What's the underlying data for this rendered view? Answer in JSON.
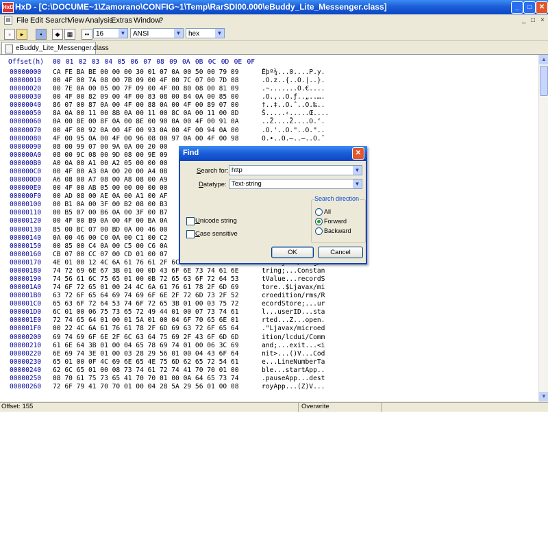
{
  "window": {
    "title": "HxD - [C:\\DOCUME~1\\Zamorano\\CONFIG~1\\Temp\\RarSDI00.000\\eBuddy_Lite_Messenger.class]",
    "app_icon": "HxD",
    "minimize": "_",
    "maximize": "□",
    "close": "✕"
  },
  "menu": {
    "items": [
      "File",
      "Edit",
      "Search",
      "View",
      "Analysis",
      "Extras",
      "Window",
      "?"
    ],
    "mdi_controls": [
      "_",
      "□",
      "×"
    ]
  },
  "toolbar": {
    "bytes_per_row": "16",
    "charset": "ANSI",
    "offset_base": "hex"
  },
  "tab": {
    "label": "eBuddy_Lite_Messenger.class"
  },
  "editor": {
    "header_label": "Offset(h)",
    "header_cols": [
      "00",
      "01",
      "02",
      "03",
      "04",
      "05",
      "06",
      "07",
      "08",
      "09",
      "0A",
      "0B",
      "0C",
      "0D",
      "0E",
      "0F"
    ],
    "rows": [
      {
        "off": "00000000",
        "hex": "CA FE BA BE 00 00 00 30 01 07 0A 00 50 00 79 09",
        "asc": "Êþº¾...0....P.y."
      },
      {
        "off": "00000010",
        "hex": "00 4F 00 7A 08 00 7B 09 00 4F 00 7C 07 00 7D 08",
        "asc": ".O.z..{..O.|..}."
      },
      {
        "off": "00000020",
        "hex": "00 7E 0A 00 05 00 7F 09 00 4F 00 80 08 00 81 09",
        "asc": ".~.......O.€...."
      },
      {
        "off": "00000030",
        "hex": "00 4F 00 82 09 00 4F 00 83 08 00 84 0A 00 85 00",
        "asc": ".O.‚..O.ƒ..„..…."
      },
      {
        "off": "00000040",
        "hex": "86 07 00 87 0A 00 4F 00 88 0A 00 4F 00 89 07 00",
        "asc": "†..‡..O.ˆ..O.‰.."
      },
      {
        "off": "00000050",
        "hex": "8A 0A 00 11 00 8B 0A 00 11 00 8C 0A 00 11 00 8D",
        "asc": "Š.....‹.....Œ...."
      },
      {
        "off": "00000060",
        "hex": "0A 00 8E 00 8F 0A 00 8E 00 90 0A 00 4F 00 91 0A",
        "asc": "..Ž....Ž....O.‘."
      },
      {
        "off": "00000070",
        "hex": "00 4F 00 92 0A 00 4F 00 93 0A 00 4F 00 94 0A 00",
        "asc": ".O.'..O.\"..O.\".."
      },
      {
        "off": "00000080",
        "hex": "4F 00 95 0A 00 4F 00 96 08 00 97 0A 00 4F 00 98",
        "asc": "O.•..O.–..—..O.˜"
      },
      {
        "off": "00000090",
        "hex": "08 00 99 07 00 9A 0A 00 20 00",
        "asc": ""
      },
      {
        "off": "000000A0",
        "hex": "08 00 9C 08 00 9D 08 00 9E 09",
        "asc": ""
      },
      {
        "off": "000000B0",
        "hex": "A0 0A 00 A1 00 A2 05 00 00 00",
        "asc": ""
      },
      {
        "off": "000000C0",
        "hex": "00 4F 00 A3 0A 00 20 00 A4 08",
        "asc": ""
      },
      {
        "off": "000000D0",
        "hex": "A6 08 00 A7 08 00 A8 08 00 A9",
        "asc": ""
      },
      {
        "off": "000000E0",
        "hex": "00 4F 00 AB 05 00 00 00 00 00",
        "asc": ""
      },
      {
        "off": "000000F0",
        "hex": "00 AD 08 00 AE 0A 00 A1 00 AF",
        "asc": ""
      },
      {
        "off": "00000100",
        "hex": "00 B1 0A 00 3F 00 B2 08 00 B3",
        "asc": ""
      },
      {
        "off": "00000110",
        "hex": "00 B5 07 00 B6 0A 00 3F 00 B7",
        "asc": ""
      },
      {
        "off": "00000120",
        "hex": "00 4F 00 B9 0A 00 4F 00 BA 0A",
        "asc": ""
      },
      {
        "off": "00000130",
        "hex": "85 00 BC 07 00 BD 0A 00 46 00",
        "asc": ""
      },
      {
        "off": "00000140",
        "hex": "0A 00 46 00 C0 0A 00 C1 00 C2",
        "asc": ""
      },
      {
        "off": "00000150",
        "hex": "00 85 00 C4 0A 00 C5 00 C6 0A",
        "asc": ""
      },
      {
        "off": "00000160",
        "hex": "CB 07 00 CC 07 00 CD 01 00 07",
        "asc": ""
      },
      {
        "off": "00000170",
        "hex": "4E 01 00 12 4C 6A 61 76 61 2F 6C 61 6E 67 2F 53",
        "asc": "N...Ljava/lang/S"
      },
      {
        "off": "00000180",
        "hex": "74 72 69 6E 67 3B 01 00 0D 43 6F 6E 73 74 61 6E",
        "asc": "tring;...Constan"
      },
      {
        "off": "00000190",
        "hex": "74 56 61 6C 75 65 01 00 0B 72 65 63 6F 72 64 53",
        "asc": "tValue...recordS"
      },
      {
        "off": "000001A0",
        "hex": "74 6F 72 65 01 00 24 4C 6A 61 76 61 78 2F 6D 69",
        "asc": "tore..$Ljavax/mi"
      },
      {
        "off": "000001B0",
        "hex": "63 72 6F 65 64 69 74 69 6F 6E 2F 72 6D 73 2F 52",
        "asc": "croedition/rms/R"
      },
      {
        "off": "000001C0",
        "hex": "65 63 6F 72 64 53 74 6F 72 65 3B 01 00 03 75 72",
        "asc": "ecordStore;...ur"
      },
      {
        "off": "000001D0",
        "hex": "6C 01 00 06 75 73 65 72 49 44 01 00 07 73 74 61",
        "asc": "l...userID...sta"
      },
      {
        "off": "000001E0",
        "hex": "72 74 65 64 01 00 01 5A 01 00 04 6F 70 65 6E 01",
        "asc": "rted...Z...open."
      },
      {
        "off": "000001F0",
        "hex": "00 22 4C 6A 61 76 61 78 2F 6D 69 63 72 6F 65 64",
        "asc": ".\"Ljavax/microed"
      },
      {
        "off": "00000200",
        "hex": "69 74 69 6F 6E 2F 6C 63 64 75 69 2F 43 6F 6D 6D",
        "asc": "ition/lcdui/Comm"
      },
      {
        "off": "00000210",
        "hex": "61 6E 64 3B 01 00 04 65 78 69 74 01 00 06 3C 69",
        "asc": "and;...exit...<i"
      },
      {
        "off": "00000220",
        "hex": "6E 69 74 3E 01 00 03 28 29 56 01 00 04 43 6F 64",
        "asc": "nit>...()V...Cod"
      },
      {
        "off": "00000230",
        "hex": "65 01 00 0F 4C 69 6E 65 4E 75 6D 62 65 72 54 61",
        "asc": "e...LineNumberTa"
      },
      {
        "off": "00000240",
        "hex": "62 6C 65 01 00 08 73 74 61 72 74 41 70 70 01 00",
        "asc": "ble...startApp.."
      },
      {
        "off": "00000250",
        "hex": "08 70 61 75 73 65 41 70 70 01 00 0A 64 65 73 74",
        "asc": ".pauseApp...dest"
      },
      {
        "off": "00000260",
        "hex": "72 6F 79 41 70 70 01 00 04 28 5A 29 56 01 00 08",
        "asc": "royApp...(Z)V..."
      }
    ]
  },
  "statusbar": {
    "offset": "Offset: 155",
    "mode": "Overwrite"
  },
  "find_dialog": {
    "title": "Find",
    "search_label_u": "S",
    "search_label_rest": "earch for:",
    "search_value": "http",
    "datatype_label_u": "D",
    "datatype_label_rest": "atatype:",
    "datatype_value": "Text-string",
    "unicode_u": "U",
    "unicode_rest": "nicode string",
    "case_u": "C",
    "case_rest": "ase sensitive",
    "direction_label": "Search direction",
    "dir_all": "All",
    "dir_forward": "Forward",
    "dir_backward": "Backward",
    "ok": "OK",
    "cancel": "Cancel"
  }
}
